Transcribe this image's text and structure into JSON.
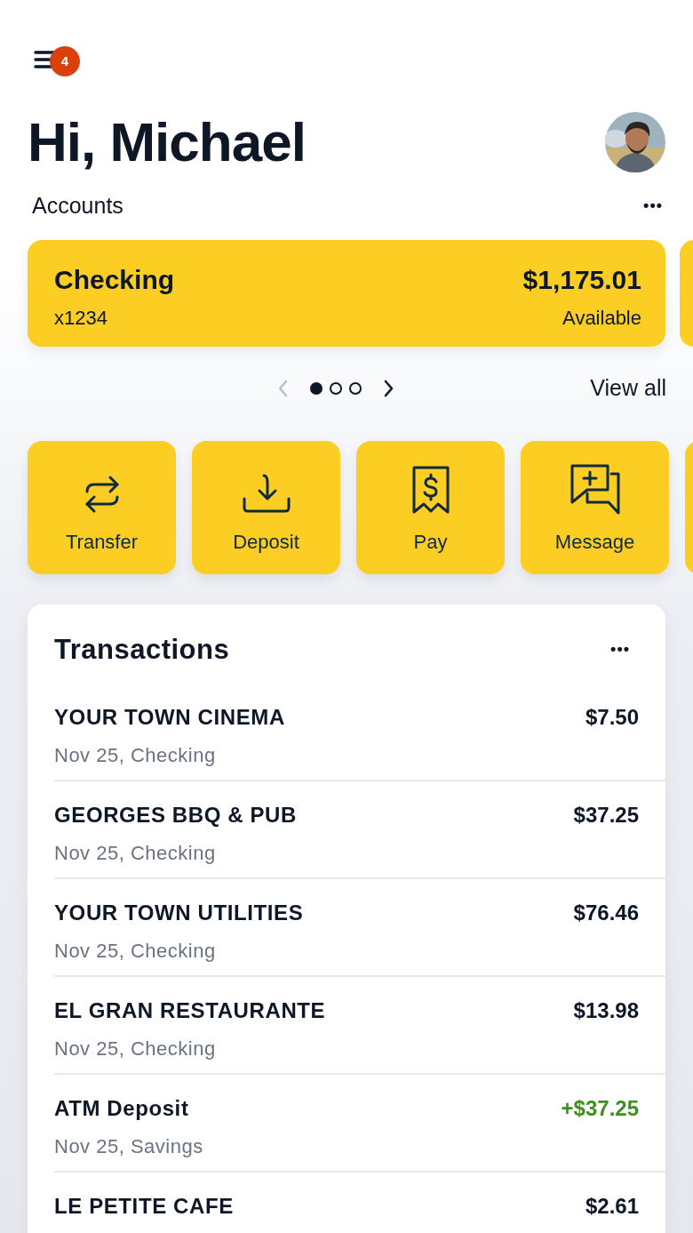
{
  "menu": {
    "badge": "4"
  },
  "greeting": "Hi, Michael",
  "accounts": {
    "title": "Accounts",
    "more": "•••",
    "cards": [
      {
        "name": "Checking",
        "number": "x1234",
        "balance": "$1,175.01",
        "balance_label": "Available"
      }
    ],
    "pager": [
      {
        "selected": true
      },
      {
        "selected": false
      },
      {
        "selected": false
      }
    ],
    "view_all": "View all"
  },
  "actions": [
    {
      "kind": "transfer",
      "label": "Transfer"
    },
    {
      "kind": "deposit",
      "label": "Deposit"
    },
    {
      "kind": "pay",
      "label": "Pay"
    },
    {
      "kind": "message",
      "label": "Message"
    }
  ],
  "transactions": {
    "title": "Transactions",
    "more": "•••",
    "rows": [
      {
        "payee": "YOUR TOWN CINEMA",
        "detail": "Nov 25, Checking",
        "amount": "$7.50",
        "kind": "debit"
      },
      {
        "payee": "GEORGES BBQ & PUB",
        "detail": "Nov 25, Checking",
        "amount": "$37.25",
        "kind": "debit"
      },
      {
        "payee": "YOUR TOWN UTILITIES",
        "detail": "Nov 25, Checking",
        "amount": "$76.46",
        "kind": "debit"
      },
      {
        "payee": "EL GRAN RESTAURANTE",
        "detail": "Nov 25, Checking",
        "amount": "$13.98",
        "kind": "debit"
      },
      {
        "payee": "ATM Deposit",
        "detail": "Nov 25, Savings",
        "amount": "+$37.25",
        "kind": "credit"
      },
      {
        "payee": "LE PETITE CAFE",
        "amount": "$2.61",
        "kind": "debit"
      }
    ]
  }
}
